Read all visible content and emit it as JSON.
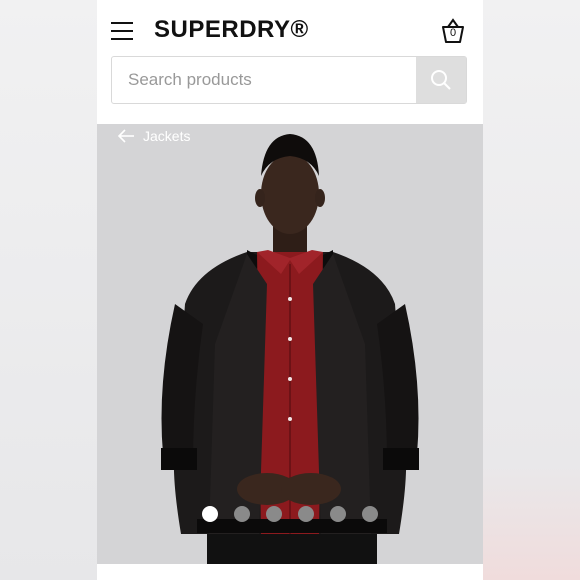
{
  "header": {
    "logo": "SUPERDRY®",
    "basket_count": "0"
  },
  "search": {
    "placeholder": "Search products"
  },
  "breadcrumb": {
    "back_label": "Jackets"
  },
  "carousel": {
    "total_dots": 6,
    "active_index": 0
  },
  "colors": {
    "background": "#d3d3d5",
    "shirt": "#8c1a1e",
    "jacket": "#1a1818"
  }
}
